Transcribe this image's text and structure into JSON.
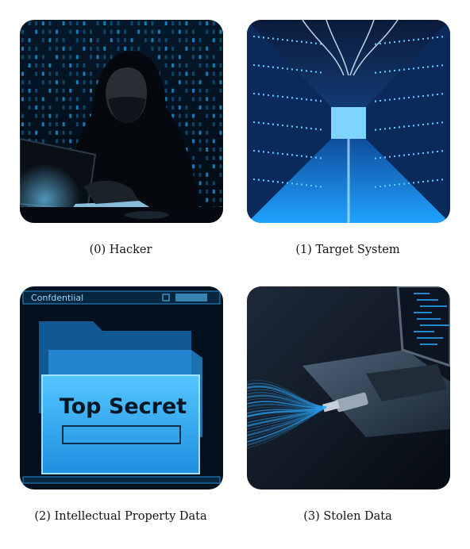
{
  "panels": [
    {
      "caption": "(0) Hacker",
      "icon": "hacker-image"
    },
    {
      "caption": "(1) Target System",
      "icon": "server-room-image"
    },
    {
      "caption": "(2) Intellectual Property Data",
      "icon": "folder-image",
      "window_title": "Confdentiial",
      "folder_label": "Top Secret"
    },
    {
      "caption": "(3) Stolen Data",
      "icon": "usb-laptop-image"
    }
  ],
  "colors": {
    "accent": "#22a7ff",
    "dark": "#03111f"
  }
}
